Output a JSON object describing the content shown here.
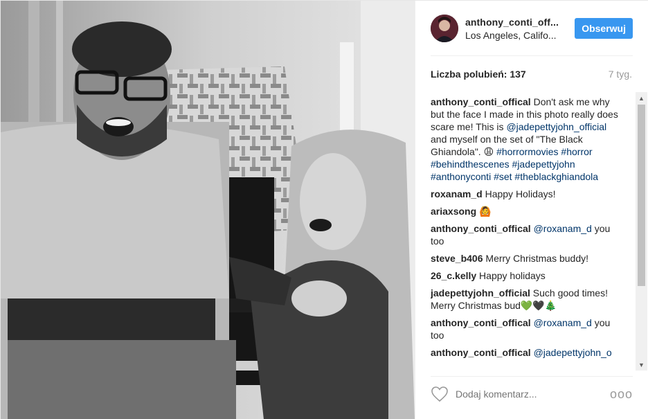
{
  "header": {
    "username": "anthony_conti_off...",
    "location": "Los Angeles, Califo...",
    "follow_label": "Obserwuj"
  },
  "stats": {
    "likes_label": "Liczba polubień: 137",
    "age": "7 tyg."
  },
  "caption": {
    "user": "anthony_conti_offical",
    "text_1": " Don't ask me why but the face I made in this photo really does scare me! This is ",
    "mention": "@jadepettyjohn_official",
    "text_2": " and myself on the set of \"The Black Ghiandola\". 😩 ",
    "hashtags": "#horrormovies #horror #behindthescenes #jadepettyjohn #anthonyconti #set #theblackghiandola"
  },
  "comments": [
    {
      "user": "roxanam_d",
      "mention": "",
      "text": " Happy Holidays!"
    },
    {
      "user": "ariaxsong",
      "mention": "",
      "text": " 🙆"
    },
    {
      "user": "anthony_conti_offical",
      "mention": " @roxanam_d",
      "text": " you too"
    },
    {
      "user": "steve_b406",
      "mention": "",
      "text": " Merry Christmas buddy!"
    },
    {
      "user": "26_c.kelly",
      "mention": "",
      "text": " Happy holidays"
    },
    {
      "user": "jadepettyjohn_official",
      "mention": "",
      "text": " Such good times! Merry Christmas bud💚🖤🎄"
    },
    {
      "user": "anthony_conti_offical",
      "mention": " @roxanam_d",
      "text": " you too"
    },
    {
      "user": "anthony_conti_offical",
      "mention": " @jadepettyjohn_o",
      "text": ""
    }
  ],
  "footer": {
    "comment_placeholder": "Dodaj komentarz...",
    "more_glyph": "ooo"
  },
  "colors": {
    "accent": "#3897f0",
    "mention_link": "#003569",
    "muted": "#999999"
  },
  "icons": {
    "like": "heart-icon",
    "more": "more-options-icon"
  }
}
